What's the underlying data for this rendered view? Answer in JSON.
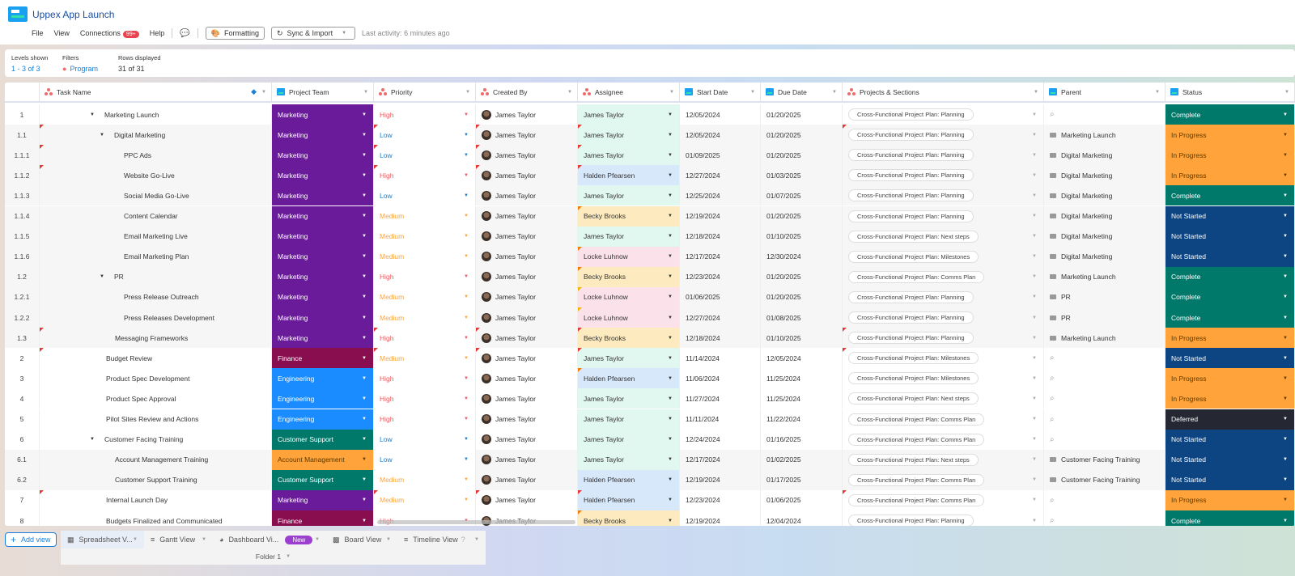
{
  "app": {
    "title": "Uppex App Launch"
  },
  "menu": {
    "file": "File",
    "view": "View",
    "connections": "Connections",
    "connections_badge": "99+",
    "help": "Help",
    "formatting": "Formatting",
    "sync_import": "Sync & Import",
    "last_activity_label": "Last activity:",
    "last_activity_value": "6 minutes ago"
  },
  "filters": {
    "levels_label": "Levels shown",
    "levels_value": "1 - 3 of 3",
    "filters_label": "Filters",
    "filters_value": "Program",
    "rows_label": "Rows displayed",
    "rows_value": "31 of 31"
  },
  "columns": [
    "Task Name",
    "Project Team",
    "Priority",
    "Created By",
    "Assignee",
    "Start Date",
    "Due Date",
    "Projects & Sections",
    "Parent",
    "Status"
  ],
  "colors": {
    "team": {
      "Marketing": "#6a1b9a",
      "Finance": "#880e4f",
      "Engineering": "#1a8cff",
      "Customer Support": "#00796b",
      "Account Management": "#ffa33a"
    },
    "priority": {
      "High": "#f0575b",
      "Low": "#1a7fd8",
      "Medium": "#ffa33a"
    },
    "assignee": {
      "James Taylor": "#e0f8ef",
      "Halden Pfearsen": "#d8e8fb",
      "Becky Brooks": "#fdebbf",
      "Locke Luhnow": "#fbe2ea"
    },
    "status": {
      "Complete": "#00796b",
      "In Progress": "#ffa33a",
      "Not Started": "#0d4583",
      "Deferred": "#252733"
    }
  },
  "rows": [
    {
      "num": "1",
      "level": 0,
      "expand": true,
      "task": "Marketing Launch",
      "team": "Marketing",
      "priority": "High",
      "created": "James Taylor",
      "assignee": "James Taylor",
      "start": "12/05/2024",
      "due": "01/20/2025",
      "section": "Cross-Functional Project Plan: Planning",
      "parent": "",
      "status": "Complete"
    },
    {
      "num": "1.1",
      "level": 1,
      "expand": true,
      "task": "Digital Marketing",
      "team": "Marketing",
      "priority": "Low",
      "created": "James Taylor",
      "assignee": "James Taylor",
      "start": "12/05/2024",
      "due": "01/20/2025",
      "section": "Cross-Functional Project Plan: Planning",
      "parent": "Marketing Launch",
      "status": "In Progress"
    },
    {
      "num": "1.1.1",
      "level": 2,
      "task": "PPC Ads",
      "team": "Marketing",
      "priority": "Low",
      "created": "James Taylor",
      "assignee": "James Taylor",
      "start": "01/09/2025",
      "due": "01/20/2025",
      "section": "Cross-Functional Project Plan: Planning",
      "parent": "Digital Marketing",
      "status": "In Progress"
    },
    {
      "num": "1.1.2",
      "level": 2,
      "task": "Website Go-Live",
      "team": "Marketing",
      "priority": "High",
      "created": "James Taylor",
      "assignee": "Halden Pfearsen",
      "start": "12/27/2024",
      "due": "01/03/2025",
      "section": "Cross-Functional Project Plan: Planning",
      "parent": "Digital Marketing",
      "status": "In Progress"
    },
    {
      "num": "1.1.3",
      "level": 2,
      "task": "Social Media Go-Live",
      "team": "Marketing",
      "priority": "Low",
      "created": "James Taylor",
      "assignee": "James Taylor",
      "start": "12/25/2024",
      "due": "01/07/2025",
      "section": "Cross-Functional Project Plan: Planning",
      "parent": "Digital Marketing",
      "status": "Complete"
    },
    {
      "num": "1.1.4",
      "level": 2,
      "task": "Content Calendar",
      "team": "Marketing",
      "priority": "Medium",
      "created": "James Taylor",
      "assignee": "Becky Brooks",
      "start": "12/19/2024",
      "due": "01/20/2025",
      "section": "Cross-Functional Project Plan: Planning",
      "parent": "Digital Marketing",
      "status": "Not Started"
    },
    {
      "num": "1.1.5",
      "level": 2,
      "task": "Email Marketing Live",
      "team": "Marketing",
      "priority": "Medium",
      "created": "James Taylor",
      "assignee": "James Taylor",
      "start": "12/18/2024",
      "due": "01/10/2025",
      "section": "Cross-Functional Project Plan: Next steps",
      "parent": "Digital Marketing",
      "status": "Not Started"
    },
    {
      "num": "1.1.6",
      "level": 2,
      "task": "Email Marketing Plan",
      "team": "Marketing",
      "priority": "Medium",
      "created": "James Taylor",
      "assignee": "Locke Luhnow",
      "start": "12/17/2024",
      "due": "12/30/2024",
      "section": "Cross-Functional Project Plan: Milestones",
      "parent": "Digital Marketing",
      "status": "Not Started"
    },
    {
      "num": "1.2",
      "level": 1,
      "expand": true,
      "task": "PR",
      "team": "Marketing",
      "priority": "High",
      "created": "James Taylor",
      "assignee": "Becky Brooks",
      "start": "12/23/2024",
      "due": "01/20/2025",
      "section": "Cross-Functional Project Plan: Comms Plan",
      "parent": "Marketing Launch",
      "status": "Complete"
    },
    {
      "num": "1.2.1",
      "level": 2,
      "task": "Press Release Outreach",
      "team": "Marketing",
      "priority": "Medium",
      "created": "James Taylor",
      "assignee": "Locke Luhnow",
      "start": "01/06/2025",
      "due": "01/20/2025",
      "section": "Cross-Functional Project Plan: Planning",
      "parent": "PR",
      "status": "Complete"
    },
    {
      "num": "1.2.2",
      "level": 2,
      "task": "Press Releases Development",
      "team": "Marketing",
      "priority": "Medium",
      "created": "James Taylor",
      "assignee": "Locke Luhnow",
      "start": "12/27/2024",
      "due": "01/08/2025",
      "section": "Cross-Functional Project Plan: Planning",
      "parent": "PR",
      "status": "Complete"
    },
    {
      "num": "1.3",
      "level": 1,
      "task": "Messaging Frameworks",
      "team": "Marketing",
      "priority": "High",
      "created": "James Taylor",
      "assignee": "Becky Brooks",
      "start": "12/18/2024",
      "due": "01/10/2025",
      "section": "Cross-Functional Project Plan: Planning",
      "parent": "Marketing Launch",
      "status": "In Progress"
    },
    {
      "num": "2",
      "level": 0,
      "task": "Budget Review",
      "team": "Finance",
      "priority": "Medium",
      "created": "James Taylor",
      "assignee": "James Taylor",
      "start": "11/14/2024",
      "due": "12/05/2024",
      "section": "Cross-Functional Project Plan: Milestones",
      "parent": "",
      "status": "Not Started"
    },
    {
      "num": "3",
      "level": 0,
      "task": "Product Spec Development",
      "team": "Engineering",
      "priority": "High",
      "created": "James Taylor",
      "assignee": "Halden Pfearsen",
      "start": "11/06/2024",
      "due": "11/25/2024",
      "section": "Cross-Functional Project Plan: Milestones",
      "parent": "",
      "status": "In Progress"
    },
    {
      "num": "4",
      "level": 0,
      "task": "Product Spec Approval",
      "team": "Engineering",
      "priority": "High",
      "created": "James Taylor",
      "assignee": "James Taylor",
      "start": "11/27/2024",
      "due": "11/25/2024",
      "section": "Cross-Functional Project Plan: Next steps",
      "parent": "",
      "status": "In Progress"
    },
    {
      "num": "5",
      "level": 0,
      "task": "Pilot Sites Review and Actions",
      "team": "Engineering",
      "priority": "High",
      "created": "James Taylor",
      "assignee": "James Taylor",
      "start": "11/11/2024",
      "due": "11/22/2024",
      "section": "Cross-Functional Project Plan: Comms Plan",
      "parent": "",
      "status": "Deferred"
    },
    {
      "num": "6",
      "level": 0,
      "expand": true,
      "task": "Customer Facing Training",
      "team": "Customer Support",
      "priority": "Low",
      "created": "James Taylor",
      "assignee": "James Taylor",
      "start": "12/24/2024",
      "due": "01/16/2025",
      "section": "Cross-Functional Project Plan: Comms Plan",
      "parent": "",
      "status": "Not Started"
    },
    {
      "num": "6.1",
      "level": 1,
      "task": "Account Management Training",
      "team": "Account Management",
      "priority": "Low",
      "created": "James Taylor",
      "assignee": "James Taylor",
      "start": "12/17/2024",
      "due": "01/02/2025",
      "section": "Cross-Functional Project Plan: Next steps",
      "parent": "Customer Facing Training",
      "status": "Not Started"
    },
    {
      "num": "6.2",
      "level": 1,
      "task": "Customer Support Training",
      "team": "Customer Support",
      "priority": "Medium",
      "created": "James Taylor",
      "assignee": "Halden Pfearsen",
      "start": "12/19/2024",
      "due": "01/17/2025",
      "section": "Cross-Functional Project Plan: Comms Plan",
      "parent": "Customer Facing Training",
      "status": "Not Started"
    },
    {
      "num": "7",
      "level": 0,
      "task": "Internal Launch Day",
      "team": "Marketing",
      "priority": "Medium",
      "created": "James Taylor",
      "assignee": "Halden Pfearsen",
      "start": "12/23/2024",
      "due": "01/06/2025",
      "section": "Cross-Functional Project Plan: Comms Plan",
      "parent": "",
      "status": "In Progress"
    },
    {
      "num": "8",
      "level": 0,
      "task": "Budgets Finalized and Communicated",
      "team": "Finance",
      "priority": "High",
      "created": "James Taylor",
      "assignee": "Becky Brooks",
      "start": "12/19/2024",
      "due": "12/04/2024",
      "section": "Cross-Functional Project Plan: Planning",
      "parent": "",
      "status": "Complete"
    }
  ],
  "tabs": {
    "add_view": "Add view",
    "spreadsheet": "Spreadsheet V...",
    "gantt": "Gantt View",
    "dashboard": "Dashboard Vi...",
    "new_badge": "New",
    "board": "Board View",
    "timeline": "Timeline View",
    "folder": "Folder 1"
  }
}
